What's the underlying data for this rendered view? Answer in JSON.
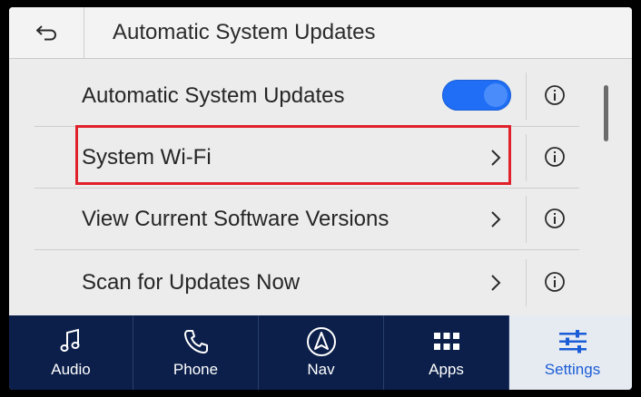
{
  "header": {
    "title": "Automatic System Updates",
    "back_icon": "back-arrow-icon"
  },
  "rows": [
    {
      "label": "Automatic System Updates",
      "control": "toggle",
      "toggle_on": true
    },
    {
      "label": "System Wi-Fi",
      "control": "chevron",
      "highlighted": true
    },
    {
      "label": "View Current Software Versions",
      "control": "chevron"
    },
    {
      "label": "Scan for Updates Now",
      "control": "chevron"
    }
  ],
  "bottom_nav": [
    {
      "label": "Audio",
      "icon": "music-note-icon"
    },
    {
      "label": "Phone",
      "icon": "phone-icon"
    },
    {
      "label": "Nav",
      "icon": "navigation-arrow-icon"
    },
    {
      "label": "Apps",
      "icon": "apps-grid-icon"
    },
    {
      "label": "Settings",
      "icon": "settings-sliders-icon",
      "active": true
    }
  ],
  "colors": {
    "accent": "#1f6ef5",
    "nav_bg": "#0b1f4a",
    "highlight": "#e0202a"
  }
}
